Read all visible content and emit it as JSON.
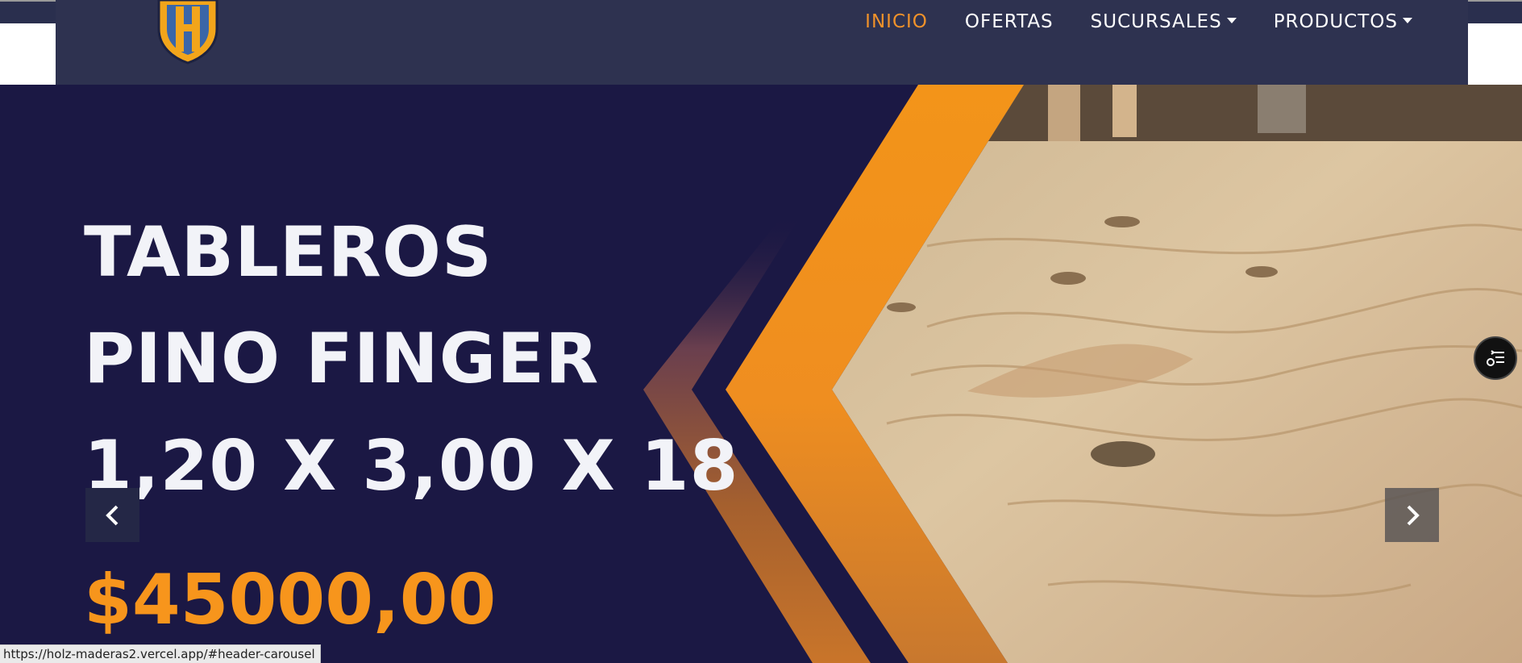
{
  "nav": {
    "items": [
      {
        "label": "INICIO",
        "active": true
      },
      {
        "label": "OFERTAS"
      },
      {
        "label": "SUCURSALES",
        "dropdown": true
      },
      {
        "label": "PRODUCTOS",
        "dropdown": true
      }
    ]
  },
  "logo": {
    "letter": "H"
  },
  "hero": {
    "line1": "TABLEROS",
    "line2": "PINO FINGER",
    "line3": "1,20 X 3,00 X 18",
    "price": "$45000,00"
  },
  "carousel": {
    "prev_icon": "chevron-left-icon",
    "next_icon": "chevron-right-icon"
  },
  "status_bar": {
    "url": "https://holz-maderas2.vercel.app/#header-carousel"
  },
  "colors": {
    "accent": "#f0922a",
    "nav_bg": "#2e3250",
    "hero_bg": "#1b1844",
    "price": "#f7951c"
  }
}
